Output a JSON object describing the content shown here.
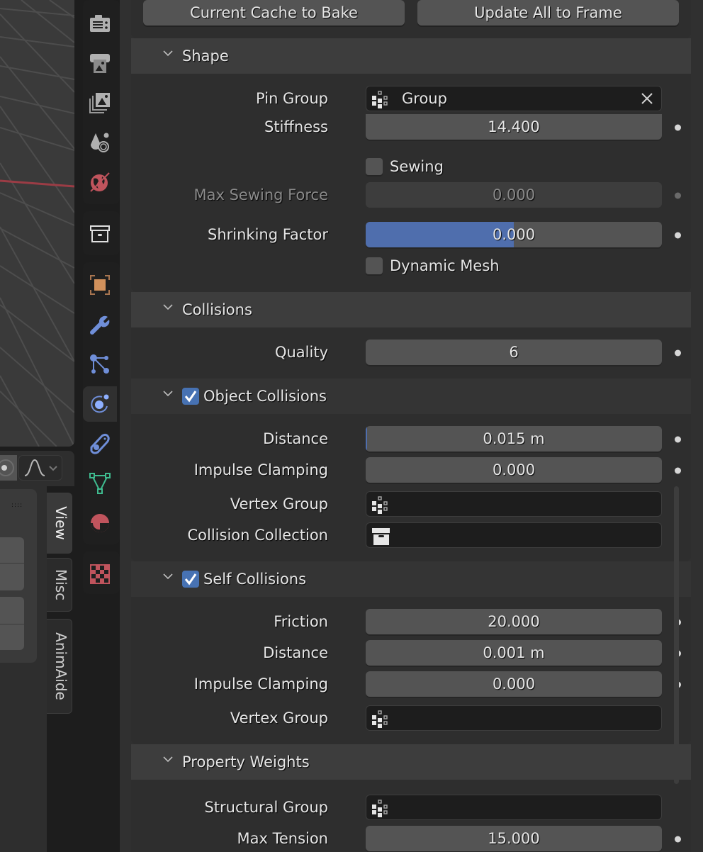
{
  "viewport_sidebar": {
    "tabs": [
      {
        "label": "View",
        "active": true
      },
      {
        "label": "Misc",
        "active": false
      },
      {
        "label": "AnimAide",
        "active": false
      }
    ],
    "falloff_icon": "proportional-falloff-smooth-icon"
  },
  "property_tabs": [
    {
      "name": "render",
      "icon": "render-camera-icon",
      "color": "#b0b0b0",
      "active": false
    },
    {
      "name": "output",
      "icon": "output-printer-icon",
      "color": "#b0b0b0",
      "active": false
    },
    {
      "name": "view-layer",
      "icon": "view-layer-images-icon",
      "color": "#b0b0b0",
      "active": false
    },
    {
      "name": "scene",
      "icon": "scene-icon",
      "color": "#b0b0b0",
      "active": false
    },
    {
      "name": "world",
      "icon": "world-icon",
      "color": "#c0545d",
      "active": false
    },
    {
      "name": "collection",
      "icon": "collection-box-icon",
      "color": "#e0e0e0",
      "active": false
    },
    {
      "name": "object",
      "icon": "object-icon",
      "color": "#d1915c",
      "active": false
    },
    {
      "name": "modifiers",
      "icon": "wrench-icon",
      "color": "#6f8ed8",
      "active": false
    },
    {
      "name": "particles",
      "icon": "particles-icon",
      "color": "#6f8ed8",
      "active": false
    },
    {
      "name": "physics",
      "icon": "physics-icon",
      "color": "#6f8ed8",
      "active": true
    },
    {
      "name": "constraints",
      "icon": "constraints-icon",
      "color": "#6f8ed8",
      "active": false
    },
    {
      "name": "data",
      "icon": "mesh-data-icon",
      "color": "#3fbb8f",
      "active": false
    },
    {
      "name": "material",
      "icon": "material-icon",
      "color": "#c0545d",
      "active": false
    },
    {
      "name": "texture",
      "icon": "texture-checker-icon",
      "color": "#c0545d",
      "active": false
    }
  ],
  "cache_buttons": {
    "current_cache_to_bake": "Current Cache to Bake",
    "update_all_to_frame": "Update All to Frame"
  },
  "shape": {
    "title": "Shape",
    "pin_group": {
      "label": "Pin Group",
      "value": "Group",
      "icon": "vertex-group-icon"
    },
    "stiffness": {
      "label": "Stiffness",
      "value": "14.400"
    },
    "sewing": {
      "label": "Sewing",
      "checked": false
    },
    "max_sewing_force": {
      "label": "Max Sewing Force",
      "value": "0.000",
      "disabled": true
    },
    "shrinking_factor": {
      "label": "Shrinking Factor",
      "value": "0.000",
      "slider_fill": 0.5
    },
    "dynamic_mesh": {
      "label": "Dynamic Mesh",
      "checked": false
    }
  },
  "collisions": {
    "title": "Collisions",
    "quality": {
      "label": "Quality",
      "value": "6"
    }
  },
  "object_collisions": {
    "title": "Object Collisions",
    "enabled": true,
    "distance": {
      "label": "Distance",
      "value": "0.015 m",
      "slider_fill": 0.003
    },
    "impulse_clamping": {
      "label": "Impulse Clamping",
      "value": "0.000"
    },
    "vertex_group": {
      "label": "Vertex Group",
      "value": "",
      "icon": "vertex-group-icon"
    },
    "collision_collection": {
      "label": "Collision Collection",
      "value": "",
      "icon": "collection-box-icon"
    }
  },
  "self_collisions": {
    "title": "Self Collisions",
    "enabled": true,
    "friction": {
      "label": "Friction",
      "value": "20.000"
    },
    "distance": {
      "label": "Distance",
      "value": "0.001 m"
    },
    "impulse_clamping": {
      "label": "Impulse Clamping",
      "value": "0.000"
    },
    "vertex_group": {
      "label": "Vertex Group",
      "value": "",
      "icon": "vertex-group-icon"
    }
  },
  "property_weights": {
    "title": "Property Weights",
    "structural_group": {
      "label": "Structural Group",
      "value": "",
      "icon": "vertex-group-icon"
    },
    "max_tension": {
      "label": "Max Tension",
      "value": "15.000"
    }
  }
}
